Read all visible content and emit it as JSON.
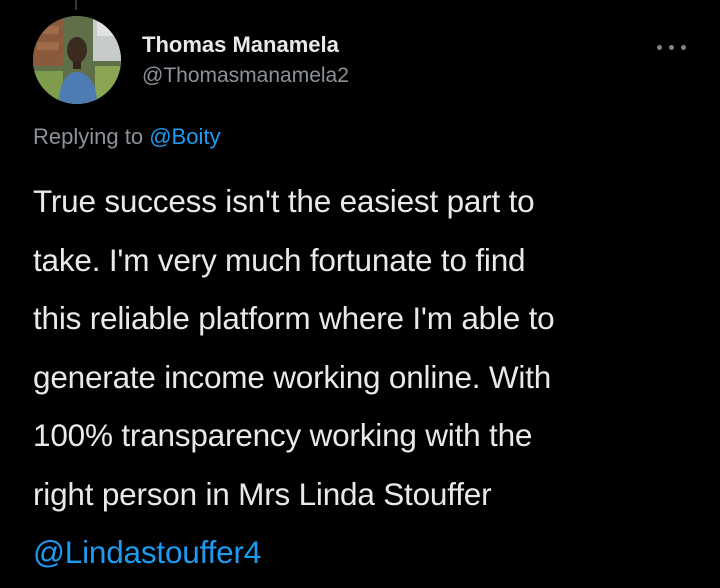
{
  "tweet": {
    "author": {
      "display_name": "Thomas Manamela",
      "handle": "@Thomasmanamela2",
      "avatar": "user-photo"
    },
    "more_options_icon": "ellipsis-icon",
    "replying_to": {
      "prefix": "Replying to",
      "mention": "@Boity"
    },
    "body_lines": [
      "True success isn't the easiest part to",
      "take. I'm very much fortunate to find",
      "this reliable platform where I'm able to",
      "generate income working online. With",
      "100% transparency working with the",
      "right person in Mrs Linda Stouffer"
    ],
    "body_mention": "@Lindastouffer4"
  },
  "colors": {
    "background": "#000000",
    "text_primary": "#e7e9ea",
    "text_secondary": "#8b9299",
    "link": "#1d9bf0"
  }
}
